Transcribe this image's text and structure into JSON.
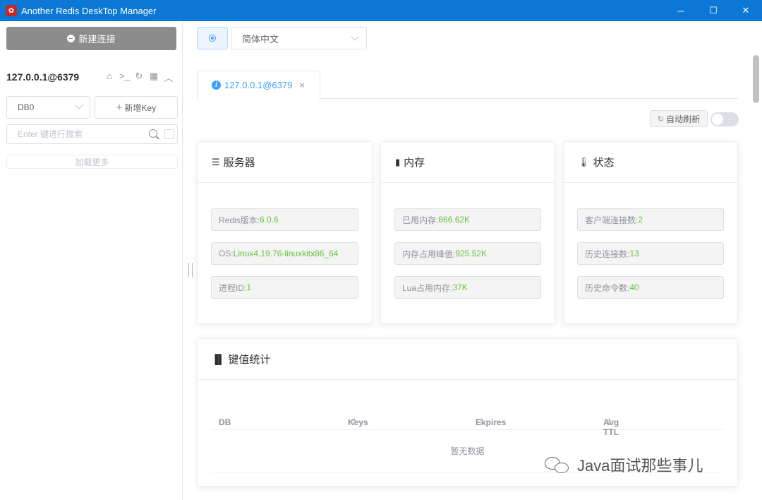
{
  "window": {
    "title": "Another Redis DeskTop Manager",
    "controls": {
      "minimize": "─",
      "maximize": "☐",
      "close": "✕"
    }
  },
  "sidebar": {
    "new_connection": "新建连接",
    "connection_name": "127.0.0.1@6379",
    "db_select": "DB0",
    "add_key": "新增Key",
    "search_placeholder": "Enter 键进行搜索",
    "load_more": "加载更多"
  },
  "topbar": {
    "language": "简体中文"
  },
  "tabs": [
    {
      "label": "127.0.0.1@6379",
      "active": true
    }
  ],
  "auto_refresh": {
    "label": "自动刷新",
    "enabled": false
  },
  "server_card": {
    "title": "服务器",
    "rows": [
      {
        "label": "Redis版本: ",
        "value": "6.0.6"
      },
      {
        "label": "OS: ",
        "value": "Linux4.19.76-linuxkitx86_64"
      },
      {
        "label": "进程ID: ",
        "value": "1"
      }
    ]
  },
  "memory_card": {
    "title": "内存",
    "rows": [
      {
        "label": "已用内存: ",
        "value": "866.62K"
      },
      {
        "label": "内存占用峰值: ",
        "value": "925.52K"
      },
      {
        "label": "Lua占用内存: ",
        "value": "37K"
      }
    ]
  },
  "status_card": {
    "title": "状态",
    "rows": [
      {
        "label": "客户端连接数: ",
        "value": "2"
      },
      {
        "label": "历史连接数: ",
        "value": "13"
      },
      {
        "label": "历史命令数: ",
        "value": "40"
      }
    ]
  },
  "key_stats": {
    "title": "键值统计",
    "columns": [
      "DB",
      "Keys",
      "Expires",
      "Avg TTL"
    ],
    "empty_text": "暂无数据"
  },
  "watermark": "Java面试那些事儿",
  "colors": {
    "titlebar": "#0a78d4",
    "accent": "#409eff",
    "value_green": "#67c23a"
  }
}
